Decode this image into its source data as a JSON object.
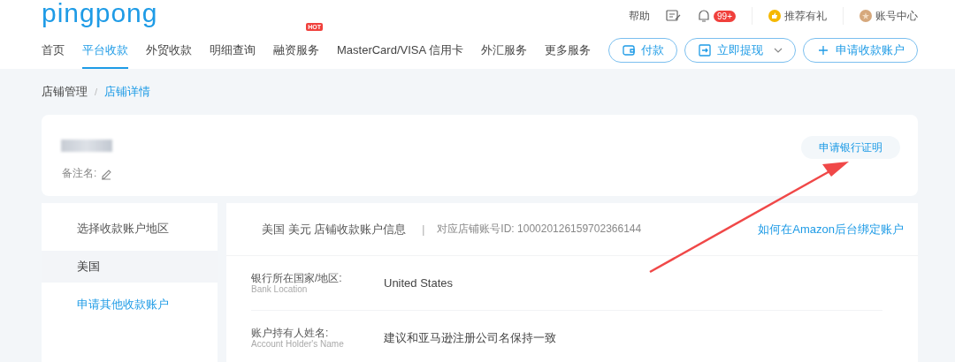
{
  "logo": "pingpong",
  "top_bar": {
    "help": "帮助",
    "notification_count": "99+",
    "referral": "推荐有礼",
    "account": "账号中心"
  },
  "nav": [
    {
      "label": "首页",
      "selected": false
    },
    {
      "label": "平台收款",
      "selected": true
    },
    {
      "label": "外贸收款",
      "selected": false
    },
    {
      "label": "明细查询",
      "selected": false
    },
    {
      "label": "融资服务",
      "selected": false,
      "badge": "HOT"
    },
    {
      "label": "MasterCard/VISA 信用卡",
      "selected": false
    },
    {
      "label": "外汇服务",
      "selected": false
    },
    {
      "label": "更多服务",
      "selected": false
    }
  ],
  "actions": [
    {
      "kind": "pay",
      "label": "付款"
    },
    {
      "kind": "withdraw",
      "label": "立即提现"
    },
    {
      "kind": "apply",
      "label": "申请收款账户"
    }
  ],
  "breadcrumb": [
    {
      "label": "店铺管理",
      "selected": false
    },
    {
      "label": "店铺详情",
      "selected": true
    }
  ],
  "breadcrumb_separator": "/",
  "store_card": {
    "remark_label": "备注名:",
    "action_button": "申请银行证明"
  },
  "regions": {
    "title": "选择收款账户地区",
    "items": [
      {
        "label": "美国",
        "selected": true
      }
    ],
    "link": "申请其他收款账户"
  },
  "account_info": {
    "title": "美国 美元 店铺收款账户信息",
    "separator": "|",
    "store_id": "对应店铺账号ID: 100020126159702366144",
    "help_link": "如何在Amazon后台绑定账户",
    "fields": [
      {
        "label": "银行所在国家/地区:",
        "label_en": "Bank Location",
        "value": "United States"
      },
      {
        "label": "账户持有人姓名:",
        "label_en": "Account Holder's Name",
        "value": "建议和亚马逊注册公司名保持一致"
      }
    ]
  }
}
